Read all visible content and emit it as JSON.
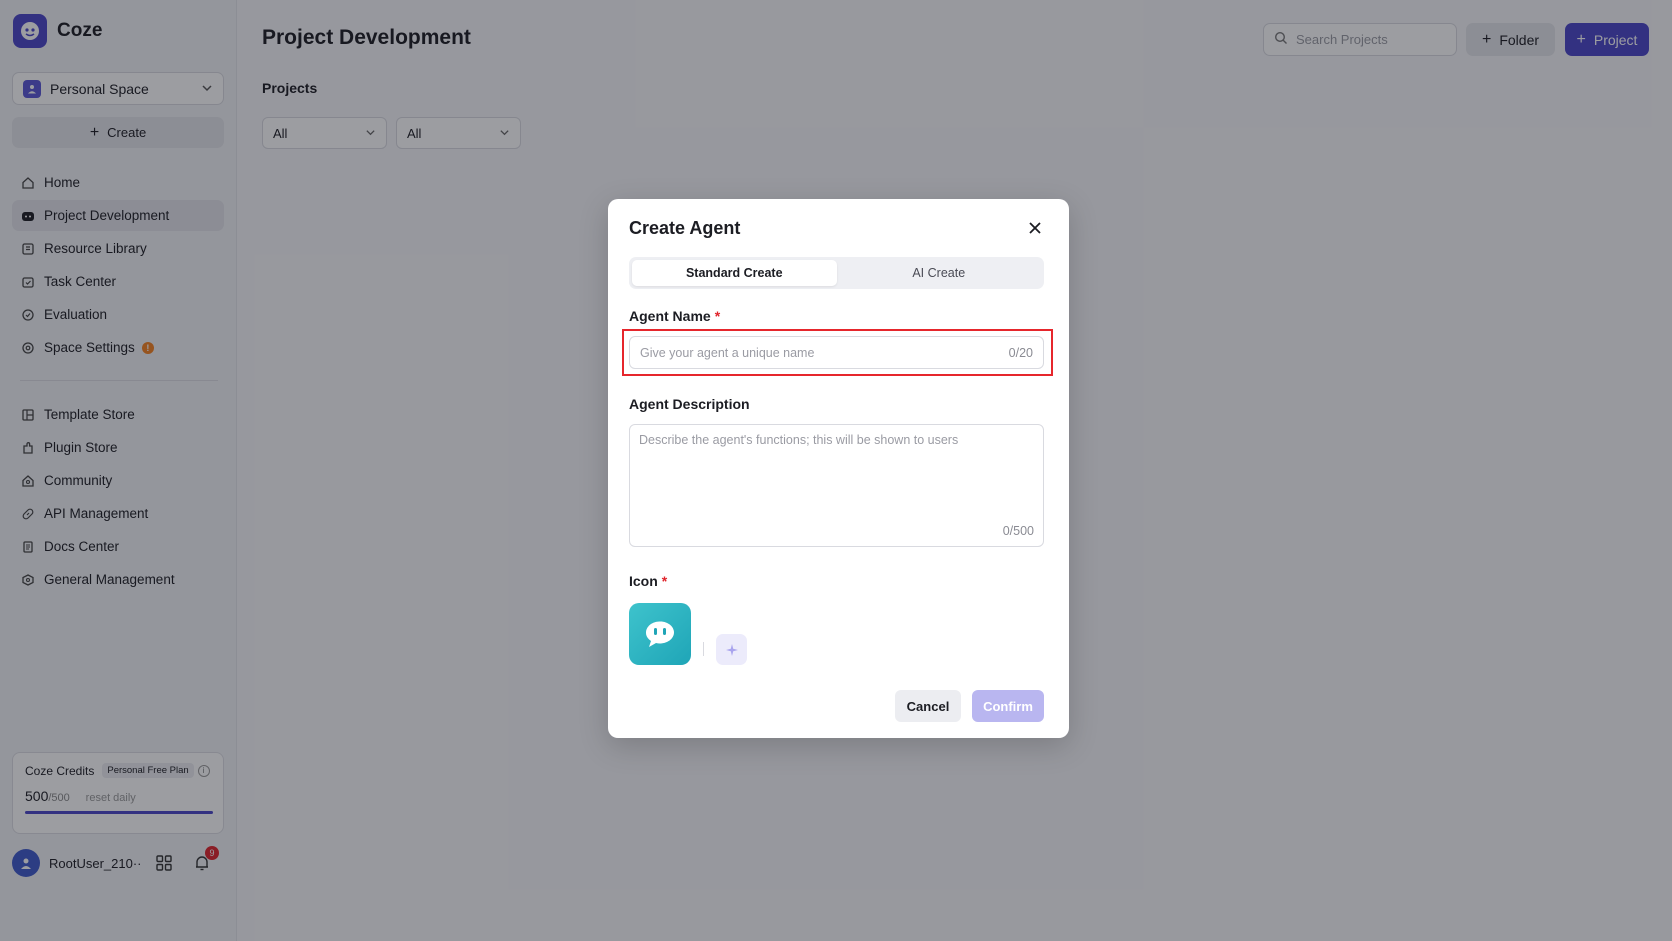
{
  "app": {
    "brand_name": "Coze"
  },
  "sidebar": {
    "space_label": "Personal Space",
    "create_label": "Create",
    "nav_primary": [
      {
        "label": "Home",
        "icon": "home-icon"
      },
      {
        "label": "Project Development",
        "icon": "project-icon",
        "active": true
      },
      {
        "label": "Resource Library",
        "icon": "library-icon"
      },
      {
        "label": "Task Center",
        "icon": "task-icon"
      },
      {
        "label": "Evaluation",
        "icon": "evaluation-icon"
      },
      {
        "label": "Space Settings",
        "icon": "settings-icon",
        "badge": "!"
      }
    ],
    "nav_secondary": [
      {
        "label": "Template Store",
        "icon": "template-icon"
      },
      {
        "label": "Plugin Store",
        "icon": "plugin-icon"
      },
      {
        "label": "Community",
        "icon": "community-icon"
      },
      {
        "label": "API Management",
        "icon": "api-icon"
      },
      {
        "label": "Docs Center",
        "icon": "docs-icon"
      },
      {
        "label": "General Management",
        "icon": "management-icon"
      }
    ],
    "credits": {
      "title": "Coze Credits",
      "plan": "Personal Free Plan",
      "value": "500",
      "total": "/500",
      "reset_note": "reset daily",
      "fraction": 1.0
    },
    "user": {
      "name": "RootUser_210···",
      "notification_count": "9"
    }
  },
  "main": {
    "page_title": "Project Development",
    "section_title": "Projects",
    "filters": [
      "All",
      "All"
    ],
    "search_placeholder": "Search Projects",
    "folder_label": "Folder",
    "project_label": "Project"
  },
  "modal": {
    "title": "Create Agent",
    "tabs": [
      {
        "label": "Standard Create",
        "active": true
      },
      {
        "label": "AI Create",
        "active": false
      }
    ],
    "name_label": "Agent Name",
    "name_placeholder": "Give your agent a unique name",
    "name_value": "",
    "name_counter": "0/20",
    "desc_label": "Agent Description",
    "desc_placeholder": "Describe the agent's functions; this will be shown to users",
    "desc_value": "",
    "desc_counter": "0/500",
    "icon_label": "Icon",
    "required_mark": "*",
    "cancel_label": "Cancel",
    "confirm_label": "Confirm"
  },
  "colors": {
    "accent": "#4b46c8",
    "highlight_border": "#e6262c",
    "agent_icon": "#2bb4c2"
  }
}
